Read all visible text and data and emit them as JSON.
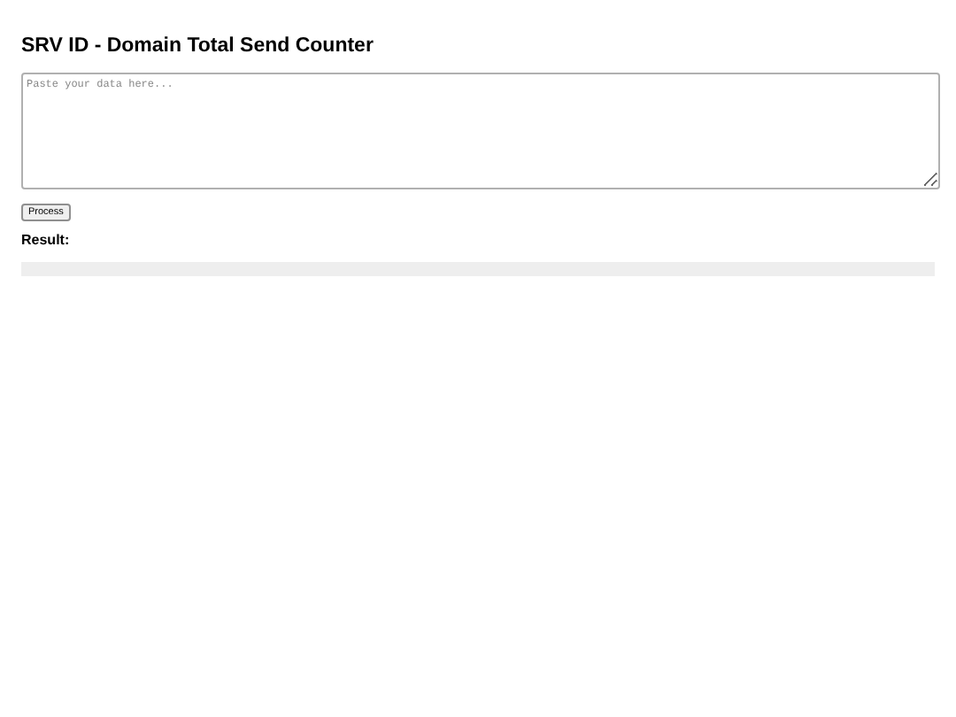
{
  "title": "SRV ID - Domain Total Send Counter",
  "input": {
    "placeholder": "Paste your data here..."
  },
  "button": "Process",
  "result_label": "Result:"
}
